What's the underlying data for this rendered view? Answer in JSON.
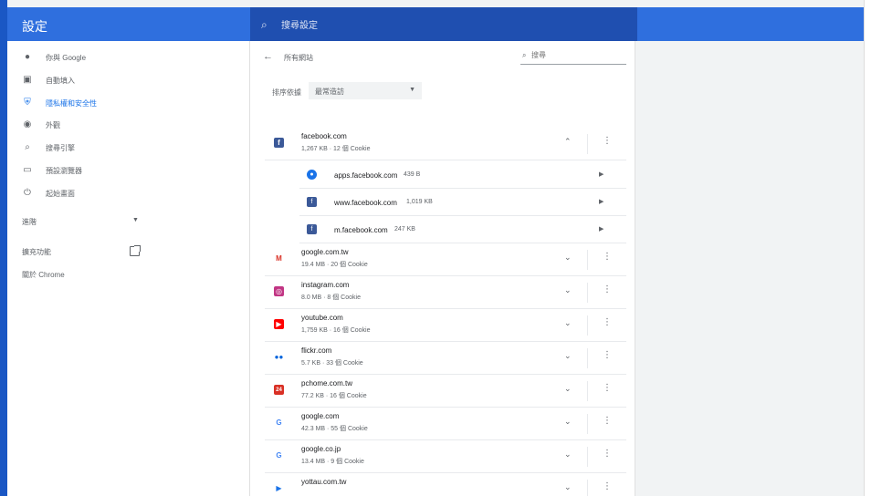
{
  "app": {
    "title": "設定",
    "search_placeholder": "搜尋設定",
    "colors": {
      "brand": "#2f6fde",
      "active": "#1a73e8"
    }
  },
  "sidebar": {
    "items": [
      {
        "label": "你與 Google",
        "icon": "person-icon"
      },
      {
        "label": "自動填入",
        "icon": "clipboard-icon"
      },
      {
        "label": "隱私權和安全性",
        "icon": "shield-icon",
        "active": true
      },
      {
        "label": "外觀",
        "icon": "palette-icon"
      },
      {
        "label": "搜尋引擎",
        "icon": "search-icon"
      },
      {
        "label": "預設瀏覽器",
        "icon": "browser-icon"
      },
      {
        "label": "起始畫面",
        "icon": "power-icon"
      }
    ],
    "advanced": "進階",
    "extensions": "擴充功能",
    "about": "關於 Chrome"
  },
  "main": {
    "back_label": "←",
    "title": "所有網站",
    "search_placeholder": "搜尋",
    "sort_label": "排序依據",
    "sort_value": "最常造訪",
    "expanded_site": {
      "name": "facebook.com",
      "meta": "1,267 KB · 12 個 Cookie",
      "children": [
        {
          "name": "apps.facebook.com",
          "size": "439 B"
        },
        {
          "name": "www.facebook.com",
          "size": "1,019 KB"
        },
        {
          "name": "m.facebook.com",
          "size": "247 KB"
        }
      ]
    },
    "sites": [
      {
        "name": "google.com.tw",
        "meta": "19.4 MB · 20 個 Cookie",
        "favicon": "gmail-icon"
      },
      {
        "name": "instagram.com",
        "meta": "8.0 MB · 8 個 Cookie",
        "favicon": "instagram-icon"
      },
      {
        "name": "youtube.com",
        "meta": "1,759 KB · 16 個 Cookie",
        "favicon": "youtube-icon"
      },
      {
        "name": "flickr.com",
        "meta": "5.7 KB · 33 個 Cookie",
        "favicon": "flickr-icon"
      },
      {
        "name": "pchome.com.tw",
        "meta": "77.2 KB · 16 個 Cookie",
        "favicon": "pchome-icon"
      },
      {
        "name": "google.com",
        "meta": "42.3 MB · 55 個 Cookie",
        "favicon": "google-icon"
      },
      {
        "name": "google.co.jp",
        "meta": "13.4 MB · 9 個 Cookie",
        "favicon": "google-icon"
      },
      {
        "name": "yottau.com.tw",
        "meta": "",
        "favicon": "play-icon"
      }
    ]
  }
}
